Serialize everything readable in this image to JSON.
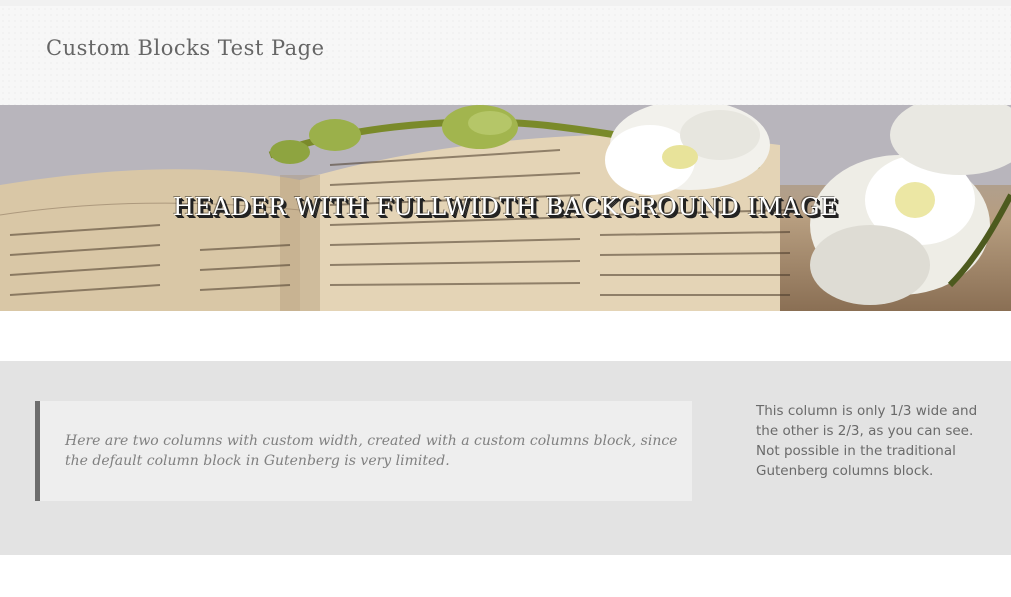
{
  "site": {
    "title": "Custom Blocks Test Page"
  },
  "hero": {
    "title": "HEADER WITH FULLWIDTH BACKGROUND IMAGE",
    "image_description_icon": "bible-and-orchid-photo"
  },
  "columns_block": {
    "quote": "Here are two columns with custom width, created with a custom columns block, since the default column block in Gutenberg is very limited.",
    "side_text": "This column is only 1/3 wide and the other is 2/3, as you can see. Not possible in the traditional Gutenberg columns block."
  },
  "colors": {
    "header_bg": "#f7f7f7",
    "section_bg": "#e3e3e3",
    "quote_bg": "#eeeeee",
    "quote_border": "#6d6d6d"
  }
}
